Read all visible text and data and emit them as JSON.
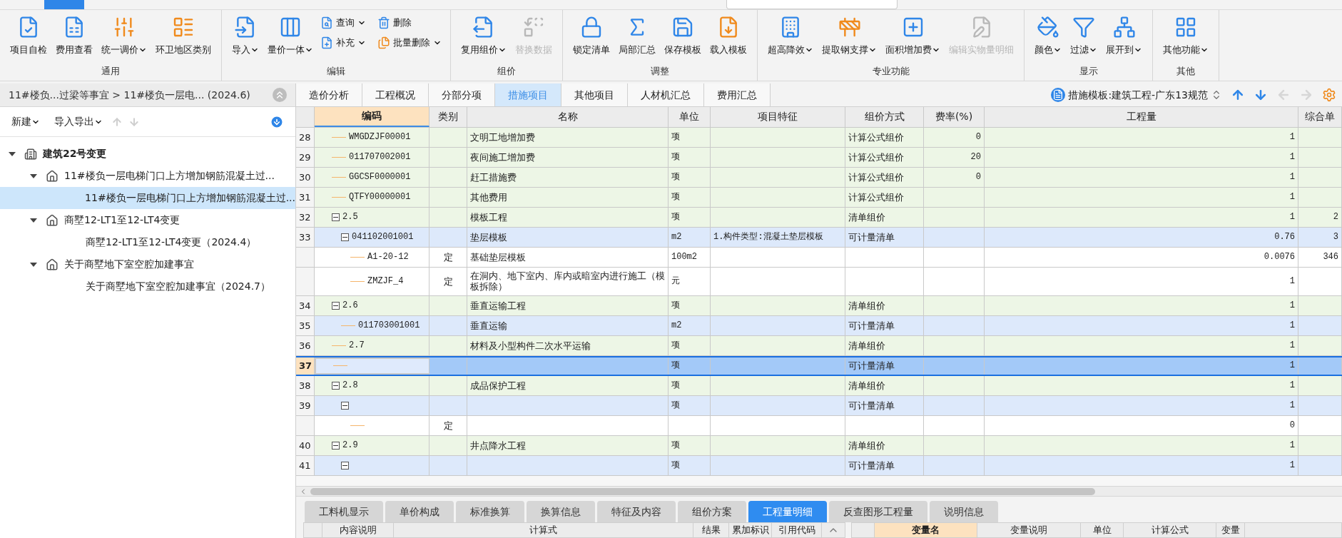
{
  "ribbon": {
    "groups": [
      {
        "label": "通用",
        "buttons": [
          {
            "label": "项目自检",
            "dropdown": false,
            "disabled": false
          },
          {
            "label": "费用查看",
            "dropdown": false,
            "disabled": false
          },
          {
            "label": "统一调价",
            "dropdown": true,
            "disabled": false
          },
          {
            "label": "环卫地区类别",
            "dropdown": false,
            "disabled": false
          }
        ]
      },
      {
        "label": "编辑",
        "buttons": [
          {
            "label": "导入",
            "dropdown": true,
            "disabled": false
          },
          {
            "label": "量价一体",
            "dropdown": true,
            "disabled": false
          },
          {
            "label": "查询",
            "dropdown": true,
            "disabled": false
          },
          {
            "label": "补充",
            "dropdown": true,
            "disabled": false
          },
          {
            "label": "删除",
            "dropdown": false,
            "disabled": false
          },
          {
            "label": "批量删除",
            "dropdown": true,
            "disabled": false
          }
        ]
      },
      {
        "label": "组价",
        "buttons": [
          {
            "label": "复用组价",
            "dropdown": true,
            "disabled": false
          },
          {
            "label": "替换数据",
            "dropdown": false,
            "disabled": true
          }
        ]
      },
      {
        "label": "调整",
        "buttons": [
          {
            "label": "锁定清单",
            "dropdown": false,
            "disabled": false
          },
          {
            "label": "局部汇总",
            "dropdown": false,
            "disabled": false
          },
          {
            "label": "保存模板",
            "dropdown": false,
            "disabled": false
          },
          {
            "label": "载入模板",
            "dropdown": false,
            "disabled": false
          }
        ]
      },
      {
        "label": "专业功能",
        "buttons": [
          {
            "label": "超高降效",
            "dropdown": true,
            "disabled": false
          },
          {
            "label": "提取钢支撑",
            "dropdown": true,
            "disabled": false
          },
          {
            "label": "面积增加费",
            "dropdown": true,
            "disabled": false
          },
          {
            "label": "编辑实物量明细",
            "dropdown": false,
            "disabled": true
          }
        ]
      },
      {
        "label": "显示",
        "buttons": [
          {
            "label": "颜色",
            "dropdown": true,
            "disabled": false
          },
          {
            "label": "过滤",
            "dropdown": true,
            "disabled": false
          },
          {
            "label": "展开到",
            "dropdown": true,
            "disabled": false
          }
        ]
      },
      {
        "label": "其他",
        "buttons": [
          {
            "label": "其他功能",
            "dropdown": true,
            "disabled": false
          }
        ]
      }
    ]
  },
  "breadcrumb": "11#楼负...过梁等事宜 > 11#楼负一层电... (2024.6)",
  "left_toolbar": [
    {
      "label": "新建",
      "dropdown": true
    },
    {
      "label": "导入导出",
      "dropdown": true
    }
  ],
  "project_tree": [
    {
      "label": "建筑22号变更",
      "kind": "project",
      "expanded": true,
      "selected": false,
      "children": [
        {
          "label": "11#楼负一层电梯门口上方增加钢筋混凝土过...",
          "kind": "unit",
          "expanded": true,
          "selected": false,
          "children": [
            {
              "label": "11#楼负一层电梯门口上方增加钢筋混凝土过...",
              "kind": "leaf",
              "selected": true
            }
          ]
        },
        {
          "label": "商墅12-LT1至12-LT4变更",
          "kind": "unit",
          "expanded": true,
          "selected": false,
          "children": [
            {
              "label": "商墅12-LT1至12-LT4变更（2024.4）",
              "kind": "leaf",
              "selected": false
            }
          ]
        },
        {
          "label": "关于商墅地下室空腔加建事宜",
          "kind": "unit",
          "expanded": true,
          "selected": false,
          "children": [
            {
              "label": "关于商墅地下室空腔加建事宜（2024.7）",
              "kind": "leaf",
              "selected": false
            }
          ]
        }
      ]
    }
  ],
  "tabs": [
    {
      "label": "造价分析",
      "selected": false
    },
    {
      "label": "工程概况",
      "selected": false
    },
    {
      "label": "分部分项",
      "selected": false
    },
    {
      "label": "措施项目",
      "selected": true
    },
    {
      "label": "其他项目",
      "selected": false
    },
    {
      "label": "人材机汇总",
      "selected": false
    },
    {
      "label": "费用汇总",
      "selected": false
    }
  ],
  "template": {
    "label": "措施模板:建筑工程-广东13规范"
  },
  "table": {
    "columns": [
      "编码",
      "类别",
      "名称",
      "单位",
      "项目特征",
      "组价方式",
      "费率(%)",
      "工程量",
      "综合单"
    ],
    "rows": [
      {
        "no": "28",
        "code": "WMGDZJF00001",
        "name": "文明工地增加费",
        "unit": "项",
        "pricing": "计算公式组价",
        "rate": "0",
        "qty": "1",
        "kind": "group",
        "selected": false
      },
      {
        "no": "29",
        "code": "011707002001",
        "name": "夜间施工增加费",
        "unit": "项",
        "pricing": "计算公式组价",
        "rate": "20",
        "qty": "1",
        "kind": "group",
        "selected": false
      },
      {
        "no": "30",
        "code": "GGCSF0000001",
        "name": "赶工措施费",
        "unit": "项",
        "pricing": "计算公式组价",
        "rate": "0",
        "qty": "1",
        "kind": "group",
        "selected": false
      },
      {
        "no": "31",
        "code": "QTFY00000001",
        "name": "其他费用",
        "unit": "项",
        "pricing": "计算公式组价",
        "qty": "1",
        "kind": "group",
        "selected": false
      },
      {
        "no": "32",
        "code": "2.5",
        "name": "模板工程",
        "unit": "项",
        "pricing": "清单组价",
        "qty": "1",
        "col_10": "2",
        "kind": "group",
        "selected": false,
        "expanded": true,
        "children": [
          {
            "no": "33",
            "code": "041102001001",
            "name": "垫层模板",
            "unit": "m2",
            "feature": "1.构件类型:混凝土垫层模板",
            "pricing": "可计量清单",
            "qty": "0.76",
            "col_10": "3",
            "kind": "item",
            "selected": false,
            "expanded": true,
            "children": [
              {
                "code": "A1-20-12",
                "type": "定",
                "name": "基础垫层模板",
                "unit": "100m2",
                "qty": "0.0076",
                "col_10": "346",
                "kind": "sub",
                "selected": false
              },
              {
                "code": "ZMZJF_4",
                "type": "定",
                "name": "在洞内、地下室内、库内或暗室内进行施工（模板拆除）",
                "unit": "元",
                "qty": "1",
                "kind": "sub",
                "selected": false
              }
            ]
          }
        ]
      },
      {
        "no": "34",
        "code": "2.6",
        "name": "垂直运输工程",
        "unit": "项",
        "pricing": "清单组价",
        "qty": "1",
        "kind": "group",
        "selected": false,
        "expanded": true,
        "children": [
          {
            "no": "35",
            "code": "011703001001",
            "name": "垂直运输",
            "unit": "m2",
            "pricing": "可计量清单",
            "qty": "1",
            "kind": "item",
            "selected": false
          }
        ]
      },
      {
        "no": "36",
        "code": "2.7",
        "name": "材料及小型构件二次水平运输",
        "unit": "项",
        "pricing": "清单组价",
        "qty": "1",
        "kind": "group",
        "selected": false
      },
      {
        "no": "37",
        "unit": "项",
        "pricing": "可计量清单",
        "qty": "1",
        "kind": "item",
        "selected": true
      },
      {
        "no": "38",
        "code": "2.8",
        "name": "成品保护工程",
        "unit": "项",
        "pricing": "清单组价",
        "qty": "1",
        "kind": "group",
        "selected": false,
        "expanded": true,
        "children": [
          {
            "no": "39",
            "unit": "项",
            "pricing": "可计量清单",
            "qty": "1",
            "kind": "item",
            "selected": false,
            "expanded": true,
            "children": [
              {
                "type": "定",
                "qty": "0",
                "kind": "sub",
                "selected": false
              }
            ]
          }
        ]
      },
      {
        "no": "40",
        "code": "2.9",
        "name": "井点降水工程",
        "unit": "项",
        "pricing": "清单组价",
        "qty": "1",
        "kind": "group",
        "selected": false,
        "expanded": true,
        "children": [
          {
            "no": "41",
            "unit": "项",
            "pricing": "可计量清单",
            "qty": "1",
            "kind": "item",
            "selected": false,
            "expanded": true
          }
        ]
      }
    ]
  },
  "bottom_tabs": [
    {
      "label": "工料机显示",
      "selected": false
    },
    {
      "label": "单价构成",
      "selected": false
    },
    {
      "label": "标准换算",
      "selected": false
    },
    {
      "label": "换算信息",
      "selected": false
    },
    {
      "label": "特征及内容",
      "selected": false
    },
    {
      "label": "组价方案",
      "selected": false
    },
    {
      "label": "工程量明细",
      "selected": true
    },
    {
      "label": "反查图形工程量",
      "selected": false
    },
    {
      "label": "说明信息",
      "selected": false
    }
  ],
  "detail_table": {
    "columns": [
      "内容说明",
      "计算式",
      "结果",
      "累加标识",
      "引用代码"
    ]
  },
  "variable_table": {
    "columns": [
      "变量名",
      "变量说明",
      "单位",
      "计算公式",
      "变量"
    ]
  }
}
